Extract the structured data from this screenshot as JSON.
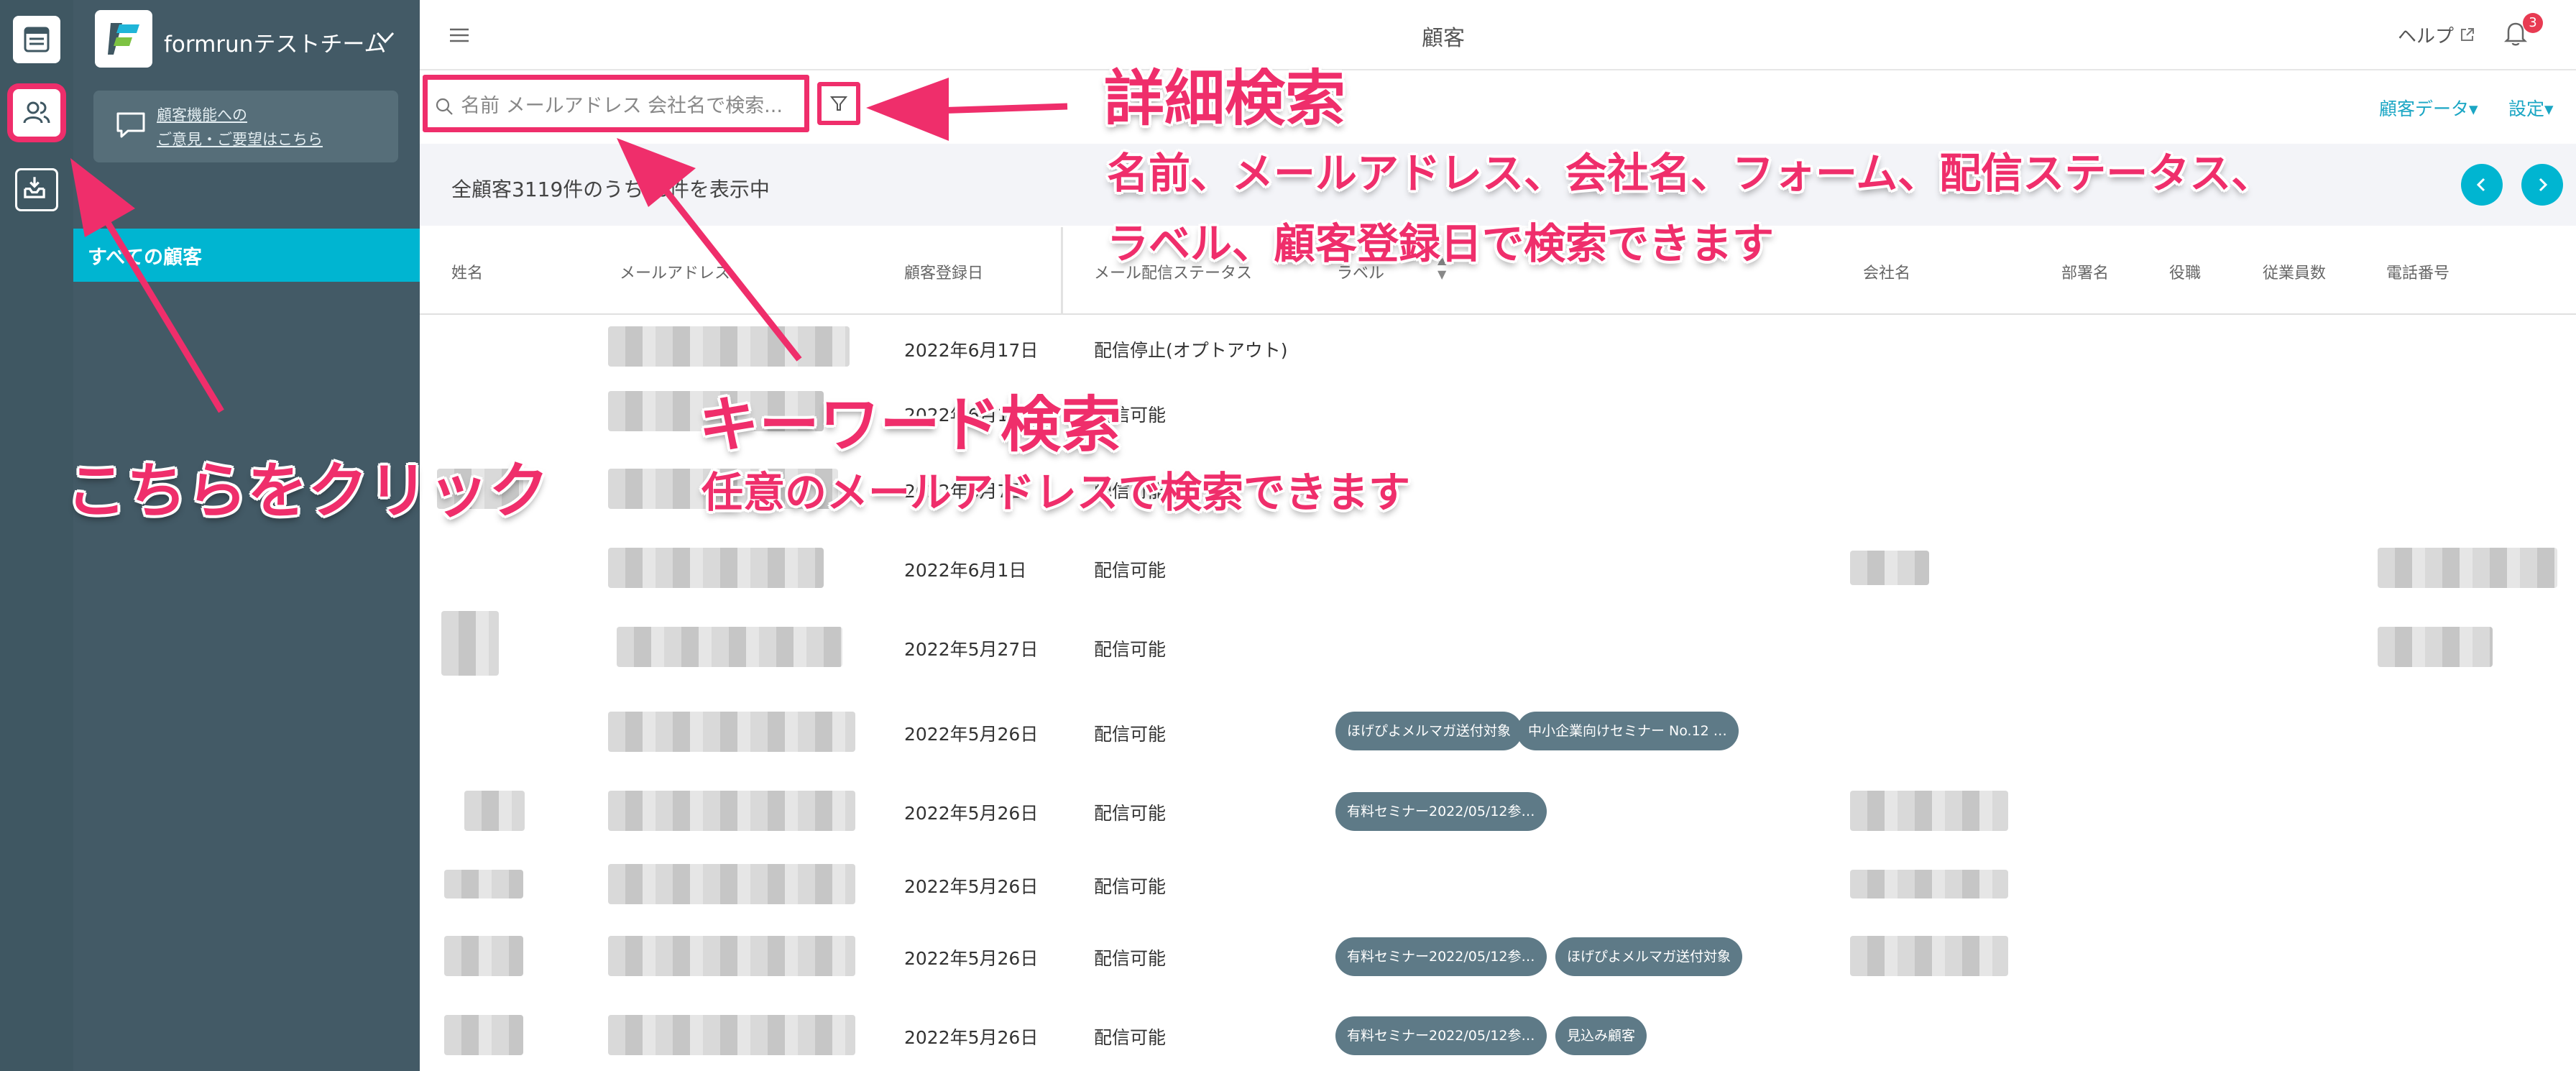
{
  "header": {
    "title": "顧客",
    "help_label": "ヘルプ",
    "notification_count": "3"
  },
  "team": {
    "name": "formrunテストチーム"
  },
  "feedback": {
    "line1": "顧客機能への",
    "line2": "ご意見・ご要望はこちら"
  },
  "sidebar": {
    "active_item": "すべての顧客"
  },
  "search": {
    "placeholder": "名前 メールアドレス 会社名で検索..."
  },
  "toolbar": {
    "customer_data": "顧客データ▾",
    "settings": "設定▾"
  },
  "info": {
    "summary": "全顧客3119件のうち50件を表示中"
  },
  "table": {
    "columns": [
      "姓名",
      "メールアドレス",
      "顧客登録日",
      "メール配信ステータス",
      "ラベル",
      "会社名",
      "部署名",
      "役職",
      "従業員数",
      "電話番号"
    ],
    "rows": [
      {
        "date": "2022年6月17日",
        "status": "配信停止(オプトアウト)",
        "labels": []
      },
      {
        "date": "2022年6月16日",
        "status": "配信可能",
        "labels": []
      },
      {
        "date": "2022年6月7日",
        "status": "配信可能",
        "labels": []
      },
      {
        "date": "2022年6月1日",
        "status": "配信可能",
        "labels": []
      },
      {
        "date": "2022年5月27日",
        "status": "配信可能",
        "labels": []
      },
      {
        "date": "2022年5月26日",
        "status": "配信可能",
        "labels": [
          "ほげぴよメルマガ送付対象",
          "中小企業向けセミナー No.12 …"
        ]
      },
      {
        "date": "2022年5月26日",
        "status": "配信可能",
        "labels": [
          "有料セミナー2022/05/12参…"
        ]
      },
      {
        "date": "2022年5月26日",
        "status": "配信可能",
        "labels": []
      },
      {
        "date": "2022年5月26日",
        "status": "配信可能",
        "labels": [
          "有料セミナー2022/05/12参…",
          "ほげぴよメルマガ送付対象"
        ]
      },
      {
        "date": "2022年5月26日",
        "status": "配信可能",
        "labels": [
          "有料セミナー2022/05/12参…",
          "見込み顧客"
        ]
      }
    ]
  },
  "annotations": {
    "detail_title": "詳細検索",
    "detail_desc1": "名前、メールアドレス、会社名、フォーム、配信ステータス、",
    "detail_desc2": "ラベル、顧客登録日で検索できます",
    "keyword_title": "キーワード検索",
    "keyword_desc": "任意のメールアドレスで検索できます",
    "click_here": "こちらをクリック"
  },
  "colors": {
    "accent_pink": "#ef2e6b",
    "teal": "#00b5d1",
    "sidebar": "#435a66",
    "rail": "#3f5762",
    "tag": "#5e7a87"
  }
}
